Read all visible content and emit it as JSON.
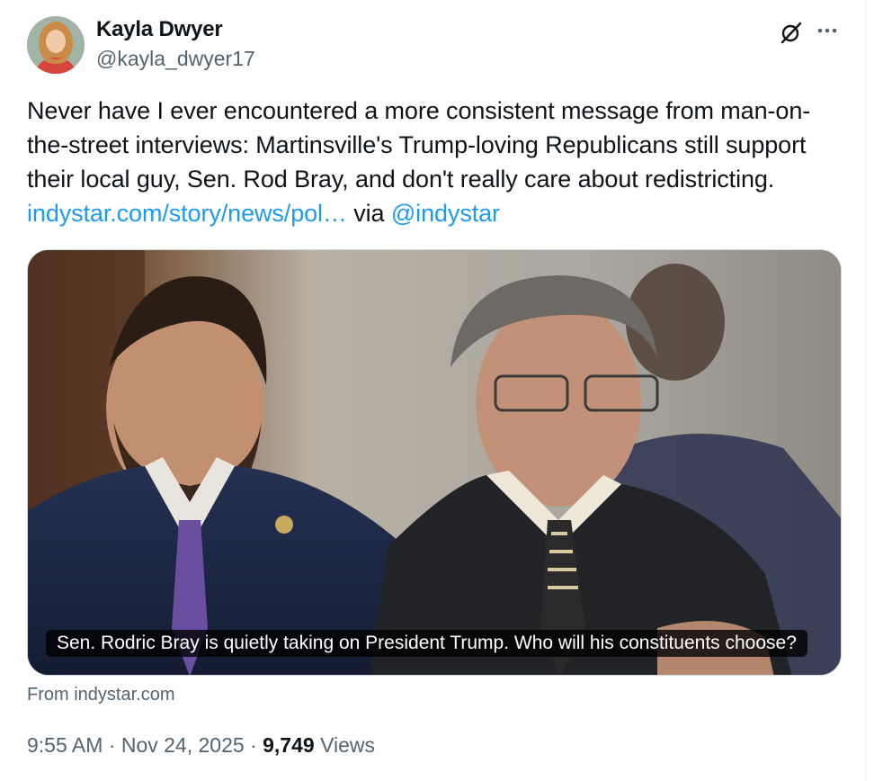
{
  "author": {
    "name": "Kayla Dwyer",
    "handle": "@kayla_dwyer17"
  },
  "icons": {
    "grok": "grok-icon",
    "more": "more-icon"
  },
  "tweet": {
    "text_before_link": "Never have I ever encountered a more consistent message from man-on-the-street interviews: Martinsville's Trump-loving Republicans still support their local guy, Sen. Rod Bray, and don't really care about redistricting. ",
    "link_text": "indystar.com/story/news/pol…",
    "via_text": " via ",
    "mention": "@indystar"
  },
  "card": {
    "caption": "Sen. Rodric Bray is quietly taking on President Trump. Who will his constituents choose?",
    "source": "From indystar.com"
  },
  "meta": {
    "time": "9:55 AM",
    "separator1": " · ",
    "date": "Nov 24, 2025",
    "separator2": " · ",
    "views_count": "9,749",
    "views_label": " Views"
  },
  "colors": {
    "link": "#1d9bf0",
    "secondary_text": "#536471",
    "primary_text": "#0f1419"
  }
}
